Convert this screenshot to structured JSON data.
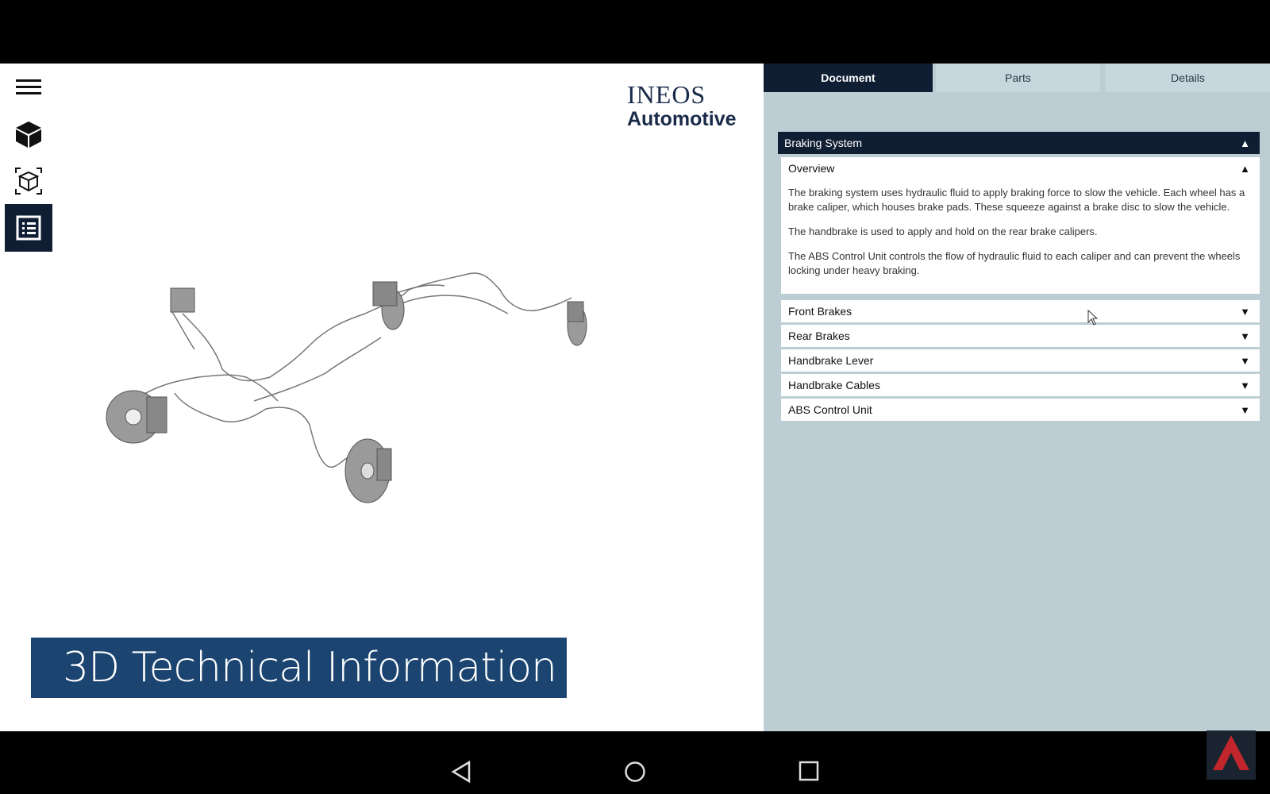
{
  "app": {
    "logo_line1": "INEOS",
    "logo_line2": "Automotive",
    "banner_text": "3D Technical Information"
  },
  "toolbar": {
    "items": [
      {
        "name": "menu",
        "icon": "hamburger-menu-icon"
      },
      {
        "name": "3d-model",
        "icon": "solid-cube-icon"
      },
      {
        "name": "exploded-view",
        "icon": "wireframe-cube-icon"
      },
      {
        "name": "document",
        "icon": "document-list-icon",
        "active": true
      }
    ]
  },
  "tabs": [
    {
      "label": "Document",
      "active": true
    },
    {
      "label": "Parts",
      "active": false
    },
    {
      "label": "Details",
      "active": false
    }
  ],
  "document": {
    "section_title": "Braking System",
    "overview_label": "Overview",
    "overview_paragraphs": [
      "The braking system uses hydraulic fluid to apply braking force to slow the vehicle. Each wheel has a brake caliper, which houses brake pads. These squeeze against a brake disc to slow the vehicle.",
      "The handbrake is used to apply and hold on the rear brake calipers.",
      "The ABS Control Unit controls the flow of hydraulic fluid to each caliper and can prevent the wheels locking under heavy braking."
    ],
    "subsections": [
      "Front Brakes",
      "Rear Brakes",
      "Handbrake Lever",
      "Handbrake Cables",
      "ABS Control Unit"
    ]
  },
  "colors": {
    "dark_navy": "#0f1e33",
    "banner_blue": "#1b4470",
    "panel_bg": "#bccdd4"
  }
}
